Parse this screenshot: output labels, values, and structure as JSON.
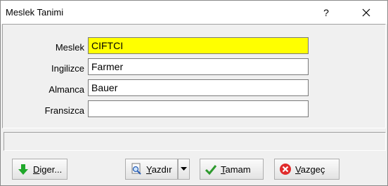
{
  "window": {
    "title": "Meslek Tanimi",
    "help_glyph": "?"
  },
  "fields": [
    {
      "label": "Meslek",
      "value": "CIFTCI"
    },
    {
      "label": "Ingilizce",
      "value": "Farmer"
    },
    {
      "label": "Almanca",
      "value": "Bauer"
    },
    {
      "label": "Fransizca",
      "value": ""
    }
  ],
  "buttons": {
    "diger": {
      "pre": "",
      "key": "D",
      "post": "iger..."
    },
    "yazdir": {
      "pre": "",
      "key": "Y",
      "post": "azdır"
    },
    "tamam": {
      "pre": "",
      "key": "T",
      "post": "amam"
    },
    "vazgec": {
      "pre": "",
      "key": "V",
      "post": "azgeç"
    }
  },
  "colors": {
    "highlight": "#ffff00"
  },
  "icons": {
    "diger": "arrow-down-icon",
    "yazdir": "print-preview-icon",
    "tamam": "checkmark-icon",
    "vazgec": "cancel-icon",
    "dropdown": "dropdown-arrow-icon",
    "close": "close-icon"
  }
}
